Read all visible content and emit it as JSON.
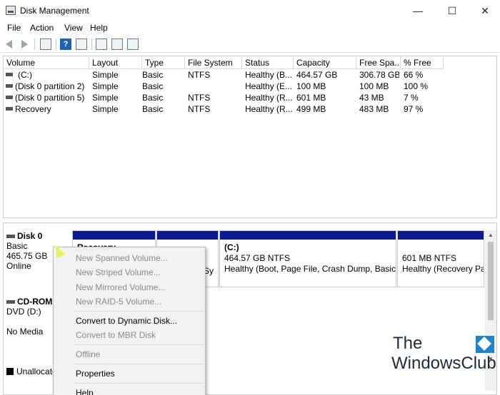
{
  "window": {
    "title": "Disk Management",
    "minimize_glyph": "—",
    "maximize_glyph": "☐",
    "close_glyph": "✕"
  },
  "menu": [
    "File",
    "Action",
    "View",
    "Help"
  ],
  "toolbar": {
    "icons": [
      "back-arrow-icon",
      "forward-arrow-icon",
      "console-tree-icon",
      "help-icon",
      "properties-icon",
      "connect-icon",
      "checklist-icon",
      "disk-list-icon"
    ],
    "help_glyph": "?"
  },
  "volume_table": {
    "columns": [
      "Volume",
      "Layout",
      "Type",
      "File System",
      "Status",
      "Capacity",
      "Free Spa...",
      "% Free"
    ],
    "rows": [
      {
        "volume": "(C:)",
        "layout": "Simple",
        "type": "Basic",
        "fs": "NTFS",
        "status": "Healthy (B...",
        "capacity": "464.57 GB",
        "free": "306.78 GB",
        "pct": "66 %"
      },
      {
        "volume": "(Disk 0 partition 2)",
        "layout": "Simple",
        "type": "Basic",
        "fs": "",
        "status": "Healthy (E...",
        "capacity": "100 MB",
        "free": "100 MB",
        "pct": "100 %"
      },
      {
        "volume": "(Disk 0 partition 5)",
        "layout": "Simple",
        "type": "Basic",
        "fs": "NTFS",
        "status": "Healthy (R...",
        "capacity": "601 MB",
        "free": "43 MB",
        "pct": "7 %"
      },
      {
        "volume": "Recovery",
        "layout": "Simple",
        "type": "Basic",
        "fs": "NTFS",
        "status": "Healthy (R...",
        "capacity": "499 MB",
        "free": "483 MB",
        "pct": "97 %"
      }
    ]
  },
  "disk0": {
    "name": "Disk 0",
    "type": "Basic",
    "size": "465.75 GB",
    "state": "Online",
    "partitions": [
      {
        "title": "Recovery",
        "line1": "",
        "line2": ""
      },
      {
        "title": "",
        "line1": "",
        "line2": "Sy"
      },
      {
        "title": "(C:)",
        "line1": "464.57 GB NTFS",
        "line2": "Healthy (Boot, Page File, Crash Dump, Basic Dat"
      },
      {
        "title": "",
        "line1": "601 MB NTFS",
        "line2": "Healthy (Recovery Par"
      }
    ]
  },
  "cdrom": {
    "name": "CD-ROM",
    "drive": "DVD (D:)",
    "media": "No Media"
  },
  "legend": {
    "unallocated": "Unallocate"
  },
  "context_menu": {
    "items": [
      {
        "label": "New Spanned Volume...",
        "enabled": false
      },
      {
        "label": "New Striped Volume...",
        "enabled": false
      },
      {
        "label": "New Mirrored Volume...",
        "enabled": false
      },
      {
        "label": "New RAID-5 Volume...",
        "enabled": false
      },
      {
        "label": "Convert to Dynamic Disk...",
        "enabled": true
      },
      {
        "label": "Convert to MBR Disk",
        "enabled": false
      },
      {
        "label": "Offline",
        "enabled": false
      },
      {
        "label": "Properties",
        "enabled": true
      },
      {
        "label": "Help",
        "enabled": true
      }
    ]
  },
  "watermark": {
    "line1": "The",
    "line2": "WindowsClub"
  },
  "colors": {
    "partition_bar": "#0b1a8c",
    "menu_bg": "#f2f2f2",
    "disabled_text": "#8a8a8a"
  }
}
